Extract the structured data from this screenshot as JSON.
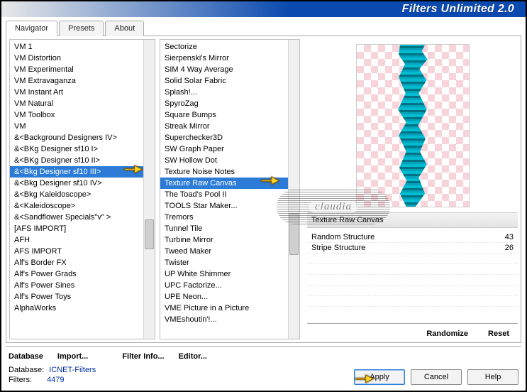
{
  "title": "Filters Unlimited 2.0",
  "tabs": [
    "Navigator",
    "Presets",
    "About"
  ],
  "active_tab": 0,
  "left_list": {
    "selected_index": 11,
    "items": [
      "VM 1",
      "VM Distortion",
      "VM Experimental",
      "VM Extravaganza",
      "VM Instant Art",
      "VM Natural",
      "VM Toolbox",
      "VM",
      "&<Background Designers IV>",
      "&<BKg Designer sf10 I>",
      "&<BKg Designer sf10 II>",
      "&<Bkg Designer sf10 III>",
      "&<Bkg Designer sf10 IV>",
      "&<Bkg Kaleidoscope>",
      "&<Kaleidoscope>",
      "&<Sandflower Specials\"v\" >",
      "[AFS IMPORT]",
      "AFH",
      "AFS IMPORT",
      "Alf's Border FX",
      "Alf's Power Grads",
      "Alf's Power Sines",
      "Alf's Power Toys",
      "AlphaWorks"
    ]
  },
  "mid_list": {
    "selected_index": 12,
    "items": [
      "Sectorize",
      "Sierpenski's Mirror",
      "SIM 4 Way Average",
      "Solid Solar Fabric",
      "Splash!...",
      "SpyroZag",
      "Square Bumps",
      "Streak Mirror",
      "Superchecker3D",
      "SW Graph Paper",
      "SW Hollow Dot",
      "Texture Noise Notes",
      "Texture Raw Canvas",
      "The Toad's Pool II",
      "TOOLS Star Maker...",
      "Tremors",
      "Tunnel Tile",
      "Turbine Mirror",
      "Tweed Maker",
      "Twister",
      "UP White Shimmer",
      "UPC Factorize...",
      "UPE Neon...",
      "VME Picture in a Picture",
      "VMEshoutin'!..."
    ]
  },
  "bottom_buttons": {
    "database": "Database",
    "import": "Import...",
    "filter_info": "Filter Info...",
    "editor": "Editor..."
  },
  "right_pane": {
    "filter_name": "Texture Raw Canvas",
    "params": [
      {
        "name": "Random Structure",
        "value": "43"
      },
      {
        "name": "Stripe Structure",
        "value": "26"
      }
    ],
    "randomize": "Randomize",
    "reset": "Reset"
  },
  "status": {
    "database_label": "Database:",
    "database_value": "ICNET-Filters",
    "filters_label": "Filters:",
    "filters_value": "4479"
  },
  "action_buttons": {
    "apply": "Apply",
    "cancel": "Cancel",
    "help": "Help"
  },
  "watermark": "claudia"
}
